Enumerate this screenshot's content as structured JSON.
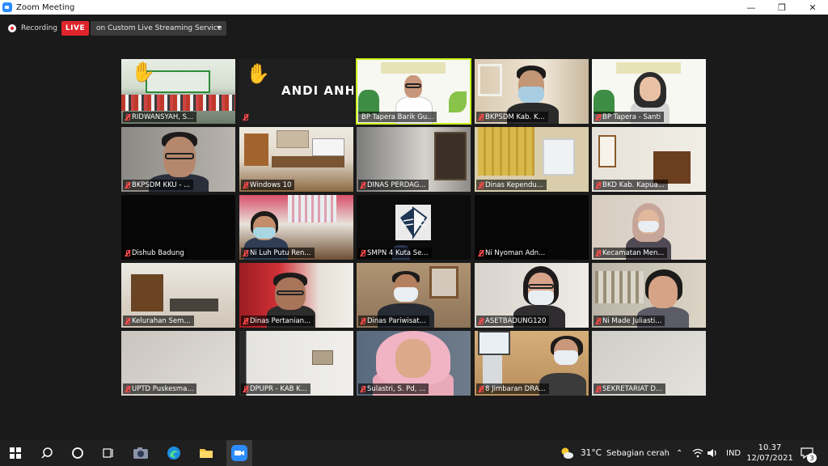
{
  "window": {
    "title": "Zoom Meeting",
    "minimize": "—",
    "maximize": "❐",
    "close": "✕"
  },
  "meeting_bar": {
    "recording_label": "Recording",
    "live_badge": "LIVE",
    "stream_target": "on Custom Live Streaming Service"
  },
  "participants": [
    {
      "name": "RIDWANSYAH, S...",
      "muted": true,
      "hand_raised": true,
      "video": "group-photo"
    },
    {
      "name": "",
      "display_text": "ANDI ANHARU...",
      "muted": true,
      "hand_raised": true,
      "video": "off"
    },
    {
      "name": "BP Tapera  Barik Gu...",
      "muted": false,
      "active_speaker": true,
      "video": "tapera-man"
    },
    {
      "name": "BKPSDM Kab. K...",
      "muted": true,
      "video": "man-mask"
    },
    {
      "name": "BP Tapera - Santi",
      "muted": true,
      "video": "tapera-woman"
    },
    {
      "name": "BKPSDM KKU - ...",
      "muted": true,
      "video": "man-glasses"
    },
    {
      "name": "Windows 10",
      "muted": true,
      "video": "office"
    },
    {
      "name": "DINAS PERDAG...",
      "muted": true,
      "video": "room-shelf"
    },
    {
      "name": "Dinas Kependu...",
      "muted": true,
      "video": "room-curtain"
    },
    {
      "name": "BKD Kab. Kapua...",
      "muted": true,
      "video": "room-cabinet"
    },
    {
      "name": "Dishub Badung",
      "muted": true,
      "video": "off"
    },
    {
      "name": "Ni Luh Putu Ren...",
      "muted": true,
      "video": "woman-mask-curtain"
    },
    {
      "name": "SMPN 4 Kuta Se...",
      "muted": true,
      "video": "emblem"
    },
    {
      "name": "Ni Nyoman Adn...",
      "muted": true,
      "video": "off"
    },
    {
      "name": "Kecamatan Men...",
      "muted": true,
      "video": "woman-hijab-mask"
    },
    {
      "name": "Kelurahan Sem...",
      "muted": true,
      "video": "room-chairs"
    },
    {
      "name": "Dinas Pertanian...",
      "muted": true,
      "video": "man-glasses-red"
    },
    {
      "name": "Dinas Pariwisat...",
      "muted": true,
      "video": "man-mask-room"
    },
    {
      "name": "ASETBADUNG120",
      "muted": true,
      "video": "woman-mask"
    },
    {
      "name": "Ni Made Juliasti...",
      "muted": true,
      "video": "woman-window"
    },
    {
      "name": "UPTD Puskesma...",
      "muted": true,
      "video": "wall"
    },
    {
      "name": "DPUPR - KAB K...",
      "muted": true,
      "video": "wall-picture"
    },
    {
      "name": "Sulastri, S. Pd, ...",
      "muted": true,
      "video": "woman-hijab"
    },
    {
      "name": "8 Jimbaran DRA...",
      "muted": true,
      "video": "woman-mask-pc"
    },
    {
      "name": "SEKRETARIAT D...",
      "muted": true,
      "video": "plain"
    }
  ],
  "taskbar": {
    "apps": [
      "windows-icon",
      "search-icon",
      "cortana-icon",
      "task-view-icon",
      "camera-icon",
      "edge-icon",
      "file-explorer-icon",
      "zoom-icon"
    ],
    "weather_temp": "31°C",
    "weather_text": "Sebagian cerah",
    "language": "IND",
    "time": "10.37",
    "date": "12/07/2021",
    "notification_count": "3"
  }
}
